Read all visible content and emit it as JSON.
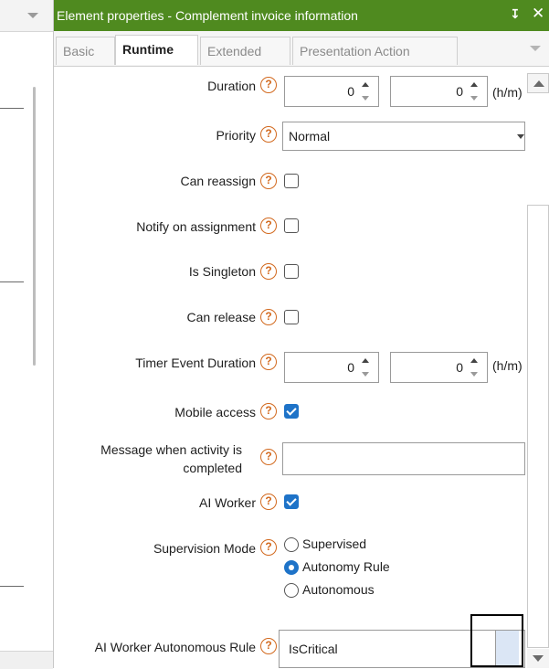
{
  "window": {
    "title": "Element properties - Complement invoice information",
    "pin_glyph": "↧",
    "close_glyph": "✕"
  },
  "tabs": [
    {
      "label": "Basic",
      "active": false
    },
    {
      "label": "Runtime",
      "active": true
    },
    {
      "label": "Extended",
      "active": false
    },
    {
      "label": "Presentation Action",
      "active": false
    }
  ],
  "help_glyph": "?",
  "fields": {
    "duration": {
      "label": "Duration",
      "value1": "0",
      "value2": "0",
      "unit": "(h/m)"
    },
    "priority": {
      "label": "Priority",
      "value": "Normal"
    },
    "can_reassign": {
      "label": "Can reassign",
      "checked": false
    },
    "notify_on_assignment": {
      "label": "Notify on assignment",
      "checked": false
    },
    "is_singleton": {
      "label": "Is Singleton",
      "checked": false
    },
    "can_release": {
      "label": "Can release",
      "checked": false
    },
    "timer_event_duration": {
      "label": "Timer Event Duration",
      "value1": "0",
      "value2": "0",
      "unit": "(h/m)"
    },
    "mobile_access": {
      "label": "Mobile access",
      "checked": true
    },
    "message_completed": {
      "label": "Message when activity is completed",
      "value": ""
    },
    "ai_worker": {
      "label": "AI Worker",
      "checked": true
    },
    "supervision_mode": {
      "label": "Supervision Mode",
      "options": [
        "Supervised",
        "Autonomy Rule",
        "Autonomous"
      ],
      "selected": "Autonomy Rule"
    },
    "ai_worker_autonomous_rule": {
      "label": "AI Worker Autonomous Rule",
      "value": "IsCritical"
    }
  },
  "colors": {
    "title_bar": "#4f8a1f",
    "help_icon": "#d2691e",
    "checked": "#1e73c8"
  }
}
